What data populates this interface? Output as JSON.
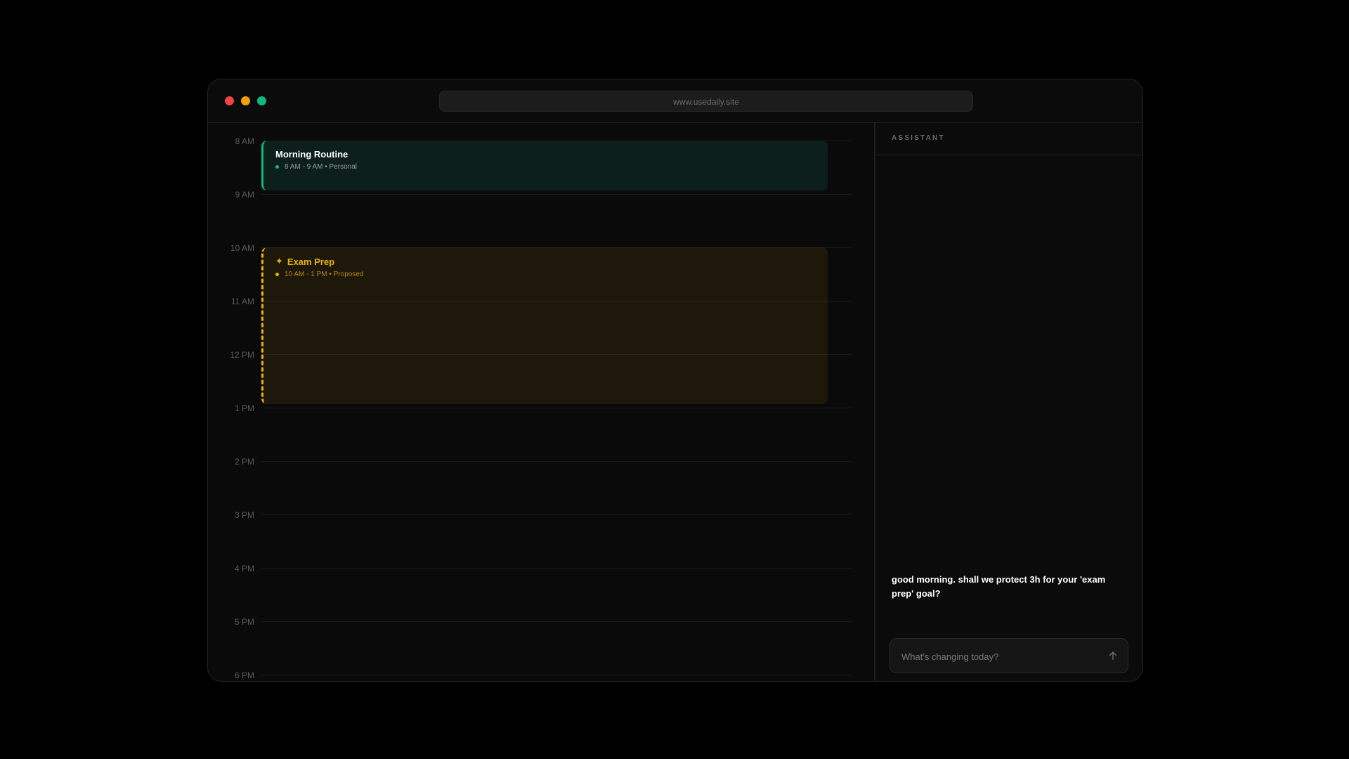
{
  "browser": {
    "url": "www.usedaily.site"
  },
  "calendar": {
    "hours": [
      "8 AM",
      "9 AM",
      "10 AM",
      "11 AM",
      "12 PM",
      "1 PM",
      "2 PM",
      "3 PM",
      "4 PM",
      "5 PM",
      "6 PM"
    ],
    "events": [
      {
        "title": "Morning Routine",
        "meta": "8 AM - 9 AM • Personal",
        "status": "personal",
        "color": "#10b981"
      },
      {
        "icon": "✦",
        "title": "Exam Prep",
        "meta": "10 AM - 1 PM • Proposed",
        "status": "proposed",
        "color": "#eab308"
      }
    ]
  },
  "assistant": {
    "header": "ASSISTANT",
    "message": "good morning. shall we protect 3h for your 'exam prep' goal?",
    "input_placeholder": "What's changing today?",
    "send_icon": "arrow-up-icon"
  },
  "colors": {
    "background": "#000000",
    "window": "#0a0a0a",
    "personal_accent": "#10b981",
    "proposed_accent": "#eab308",
    "close": "#ef4444",
    "minimize": "#f59e0b",
    "maximize": "#10b981"
  }
}
